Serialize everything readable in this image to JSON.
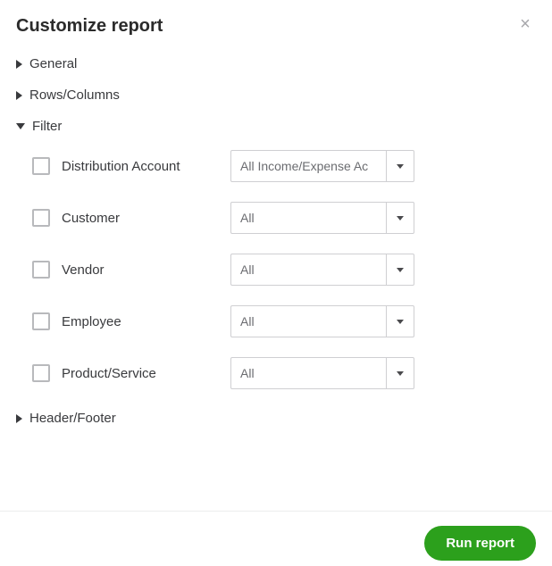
{
  "header": {
    "title": "Customize report"
  },
  "sections": {
    "general": "General",
    "rows_columns": "Rows/Columns",
    "filter": "Filter",
    "header_footer": "Header/Footer"
  },
  "filters": {
    "distribution_account": {
      "label": "Distribution Account",
      "value": "All Income/Expense Ac"
    },
    "customer": {
      "label": "Customer",
      "value": "All"
    },
    "vendor": {
      "label": "Vendor",
      "value": "All"
    },
    "employee": {
      "label": "Employee",
      "value": "All"
    },
    "product_service": {
      "label": "Product/Service",
      "value": "All"
    }
  },
  "footer": {
    "run_label": "Run report"
  }
}
